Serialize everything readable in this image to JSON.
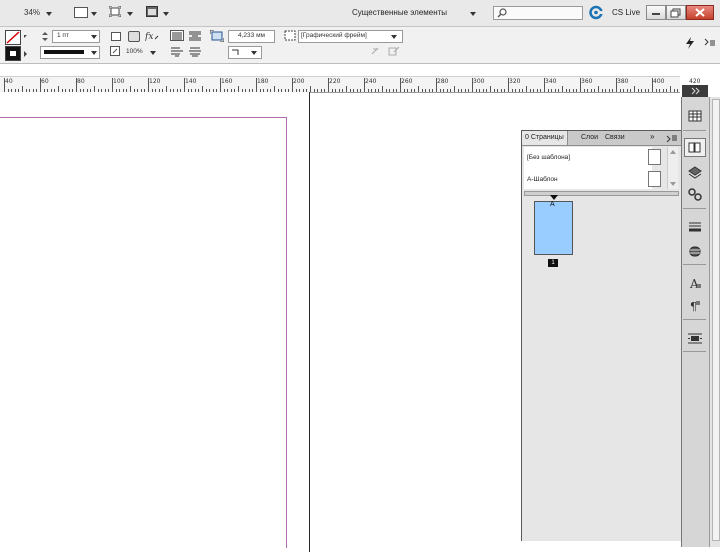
{
  "appbar": {
    "zoom": "34%",
    "workspace": "Существенные элементы",
    "search_placeholder": "",
    "cslive_label": "CS Live"
  },
  "control": {
    "stroke_weight": "1 пт",
    "scale_percent": "100%",
    "dimension_value": "4,233 мм",
    "frame_name": "[Графический фрейм]"
  },
  "ruler": {
    "labels": [
      "40",
      "60",
      "80",
      "100",
      "120",
      "140",
      "160",
      "180",
      "200",
      "220",
      "240",
      "260",
      "280",
      "300",
      "320",
      "340",
      "360",
      "380",
      "400",
      "420"
    ]
  },
  "pages_panel": {
    "tabs": [
      "Страницы",
      "Слои",
      "Связи"
    ],
    "tab_marker": "0",
    "more_label": "»",
    "masters": [
      "[Без шаблона]",
      "А-Шаблон"
    ],
    "page_master_letter": "A",
    "page_number": "1"
  },
  "colors": {
    "panel_bg": "#e6e6e6",
    "page_thumb": "#99ccff",
    "margin_guide": "#b06cb0",
    "accent_cslive": "#1b73b6"
  }
}
